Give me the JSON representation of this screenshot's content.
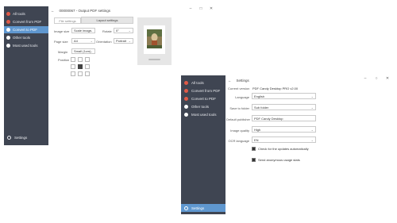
{
  "back_window": {
    "title": "00000067 - Output PDF settings",
    "sidebar": {
      "items": [
        {
          "label": "All tools"
        },
        {
          "label": "Convert from PDF"
        },
        {
          "label": "Convert to PDF"
        },
        {
          "label": "Other tools"
        },
        {
          "label": "Most used tools"
        }
      ],
      "settings_label": "Settings"
    },
    "tabs": {
      "file_settings": "File settings",
      "layout_settings": "Layout settings"
    },
    "image_size": {
      "label": "Image size",
      "value": "Scale image"
    },
    "rotate": {
      "label": "Rotate",
      "value": "0°"
    },
    "page_size": {
      "label": "Page size",
      "value": "A4"
    },
    "orientation": {
      "label": "Orientation",
      "value": "Portrait"
    },
    "margin": {
      "label": "Margin",
      "value": "Small (1cm)"
    },
    "position": {
      "label": "Position"
    }
  },
  "front_window": {
    "title": "Settings",
    "sidebar": {
      "items": [
        {
          "label": "All tools"
        },
        {
          "label": "Convert from PDF"
        },
        {
          "label": "Convert to PDF"
        },
        {
          "label": "Other tools"
        },
        {
          "label": "Most used tools"
        }
      ],
      "settings_label": "Settings"
    },
    "current_version": {
      "label": "Current version",
      "value": "PDF Candy Desktop PRO v2.00"
    },
    "language": {
      "label": "Language",
      "value": "English"
    },
    "save_to_folder": {
      "label": "Save to folder",
      "value": "Sub folder"
    },
    "default_publisher": {
      "label": "Default publisher",
      "value": "PDF Candy Desktop"
    },
    "image_quality": {
      "label": "Image quality",
      "value": "High"
    },
    "ocr_language": {
      "label": "OCR language",
      "value": "EN"
    },
    "check_updates": {
      "label": "Check for the updates automatically",
      "checked": true
    },
    "send_stats": {
      "label": "Send anonymous usage stats",
      "checked": true
    }
  }
}
